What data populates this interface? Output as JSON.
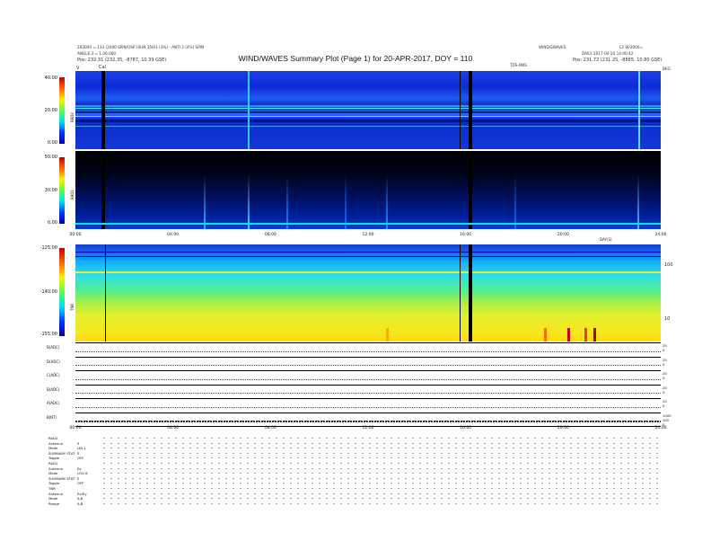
{
  "header": {
    "title": "WIND/WAVES Summary Plot (Page 1) for 20-APR-2017, DOY = 110",
    "meta_left_1": "160000 = 133 (2000 SPIN/OSP (SUN 350/1 (3%) - ANTI 2 (4%) SPIN",
    "meta_left_2": "ANGLE 3 = 1.00.000",
    "meta_right_1": "WIND/SWAVES",
    "meta_right_2": "L2 W/2000=",
    "meta_right_3": "DAILY 2017-04-20 14:00:42",
    "pos_left": "Pos: 232.31 (232.35, -8787, 10.39 GSE)",
    "pos_right": "Pos: 231.72 (231.25, -8885, 10.80 GSE)",
    "cal_label": "Cal",
    "mark_v": "V",
    "mark_right": "BKG",
    "tds_label": "TDS-MKS"
  },
  "chart_data": [
    {
      "type": "heatmap",
      "panel": "RAD2",
      "ylim": [
        0,
        40
      ],
      "yticks": [
        "40.00",
        "20.00",
        "0.00"
      ],
      "ylabel": "RAD2"
    },
    {
      "type": "heatmap",
      "panel": "RAD1",
      "ylim": [
        0,
        50
      ],
      "yticks": [
        "50.00",
        "30.00",
        "0.00"
      ],
      "ylabel": "RAD1",
      "xticks": [
        "00:00",
        "04:00",
        "08:00",
        "12:00",
        "16:00",
        "20:00",
        "24:00"
      ]
    },
    {
      "type": "heatmap",
      "panel": "TNR",
      "ylim": [
        -155,
        -125
      ],
      "yticks": [
        "-125.00",
        "-140.00",
        "-155.00"
      ],
      "ylabel": "TNR",
      "right_ticks": [
        "100",
        "10"
      ],
      "right_label": "DAY(S)"
    },
    {
      "type": "line",
      "panel": "swaves",
      "rows": [
        {
          "label": "B(ADC)",
          "right": [
            "25",
            "0"
          ]
        },
        {
          "label": "D(ADC)",
          "right": [
            "25",
            "0"
          ]
        },
        {
          "label": "C(ADC)",
          "right": [
            "25",
            "0"
          ]
        },
        {
          "label": "B(ADC)",
          "right": [
            "25",
            "0"
          ]
        },
        {
          "label": "A(ADC)",
          "right": [
            "25",
            "0"
          ]
        },
        {
          "label": "B(NT)",
          "right": [
            "1000",
            "100",
            "0"
          ]
        }
      ],
      "xticks": [
        "00:00",
        "04:00",
        "08:00",
        "12:00",
        "16:00",
        "20:00",
        "24:00"
      ]
    }
  ],
  "config": [
    {
      "k": "RAD2",
      "v": ""
    },
    {
      "k": "Antenna",
      "v": "S"
    },
    {
      "k": "Mode",
      "v": "LIN 1"
    },
    {
      "k": "SUMMARY STAT",
      "v": "S"
    },
    {
      "k": "Toggle",
      "v": "OFF"
    },
    {
      "k": "RAD1",
      "v": ""
    },
    {
      "k": "Antenna",
      "v": "Ex"
    },
    {
      "k": "Mode",
      "v": "LOG 8"
    },
    {
      "k": "SUMMARY STAT",
      "v": "S"
    },
    {
      "k": "Toggle",
      "v": "OFF"
    },
    {
      "k": "TNR",
      "v": ""
    },
    {
      "k": "Antenna",
      "v": "Ex/Ey"
    },
    {
      "k": "Mode",
      "v": "A,B"
    },
    {
      "k": "Range",
      "v": "A,B"
    }
  ]
}
